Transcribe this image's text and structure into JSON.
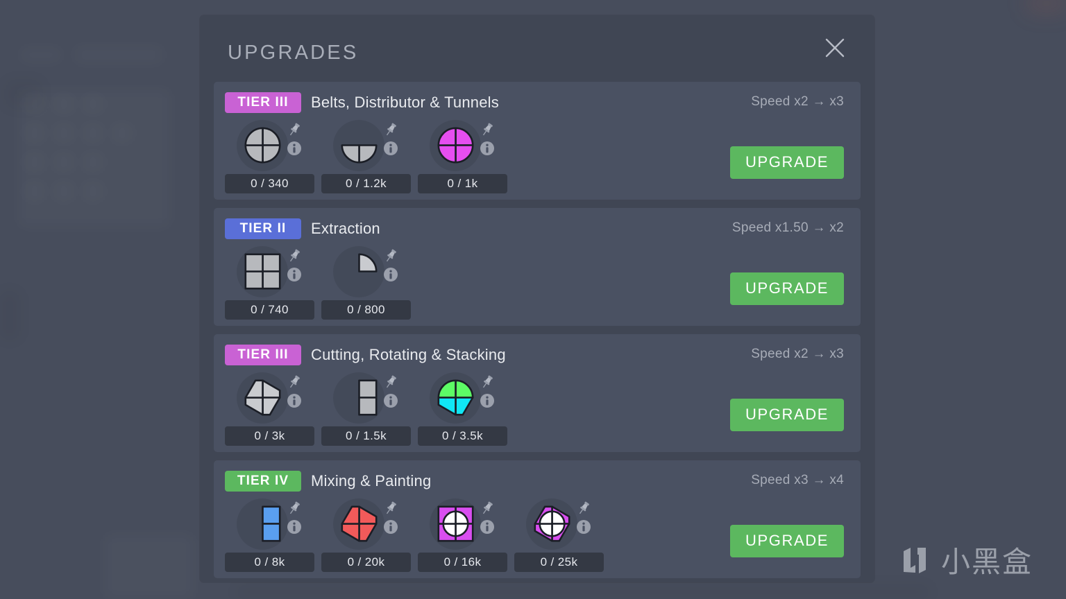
{
  "modal": {
    "title": "UPGRADES",
    "close_icon": "close-icon"
  },
  "colors": {
    "tier_purple": "#c962d4",
    "tier_blue": "#5a6fd8",
    "tier_green": "#5cb85f",
    "upgrade_button": "#5cb85f",
    "card_bg": "#4a5162",
    "modal_bg": "#404654",
    "page_bg": "#474d5c"
  },
  "watermark": {
    "text": "小黑盒"
  },
  "cards": [
    {
      "tier_label": "TIER III",
      "tier_color": "#c962d4",
      "title": "Belts, Distributor & Tunnels",
      "speed": "Speed x2 → x3",
      "button_label": "UPGRADE",
      "requirements": [
        {
          "progress": "0 / 340",
          "shape": "circle-quad-gray"
        },
        {
          "progress": "0 / 1.2k",
          "shape": "half-circle-gray"
        },
        {
          "progress": "0 / 1k",
          "shape": "circle-quad-purple"
        }
      ]
    },
    {
      "tier_label": "TIER II",
      "tier_color": "#5a6fd8",
      "title": "Extraction",
      "speed": "Speed x1.50 → x2",
      "button_label": "UPGRADE",
      "requirements": [
        {
          "progress": "0 / 740",
          "shape": "square-quad-gray"
        },
        {
          "progress": "0 / 800",
          "shape": "quarter-circle-gray"
        }
      ]
    },
    {
      "tier_label": "TIER III",
      "tier_color": "#c962d4",
      "title": "Cutting, Rotating & Stacking",
      "speed": "Speed x2 → x3",
      "button_label": "UPGRADE",
      "requirements": [
        {
          "progress": "0 / 3k",
          "shape": "windmill-gray"
        },
        {
          "progress": "0 / 1.5k",
          "shape": "rect-half-gray"
        },
        {
          "progress": "0 / 3.5k",
          "shape": "circle-windmill-green-cyan"
        }
      ]
    },
    {
      "tier_label": "TIER IV",
      "tier_color": "#5cb85f",
      "title": "Mixing & Painting",
      "speed": "Speed x3 → x4",
      "button_label": "UPGRADE",
      "requirements": [
        {
          "progress": "0 / 8k",
          "shape": "rect-half-blue"
        },
        {
          "progress": "0 / 20k",
          "shape": "windmill-red"
        },
        {
          "progress": "0 / 16k",
          "shape": "square-purple-circle-white"
        },
        {
          "progress": "0 / 25k",
          "shape": "windmill-purple-circle-white"
        }
      ]
    }
  ]
}
